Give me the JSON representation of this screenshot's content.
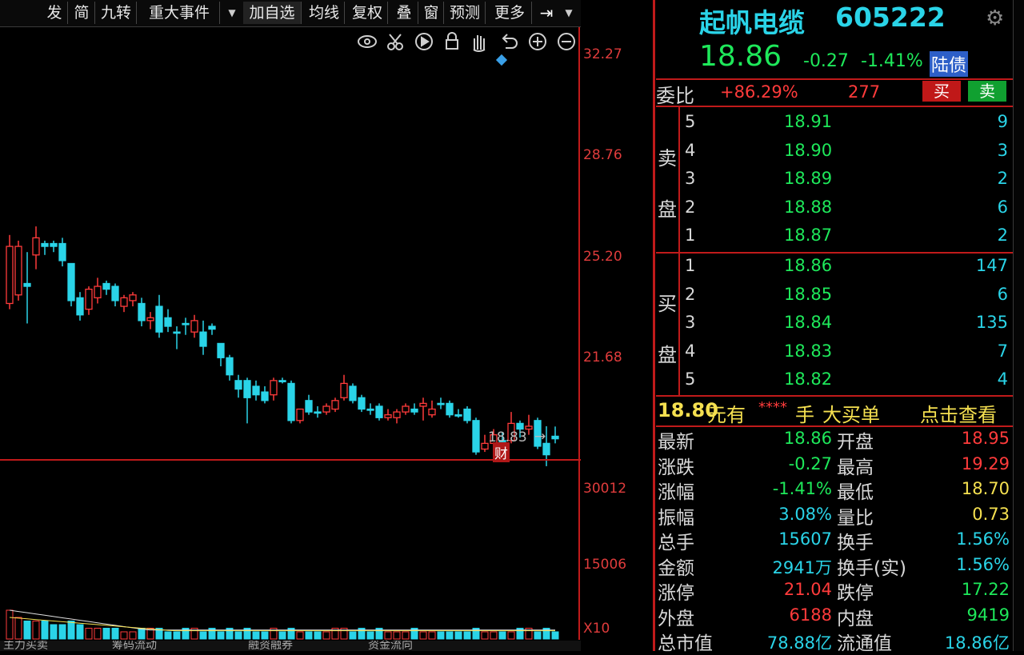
{
  "toolbar": {
    "items": [
      "发",
      "简",
      "九转",
      "重大事件",
      "加自选",
      "均线",
      "复权",
      "叠",
      "窗",
      "预测",
      "更多"
    ],
    "tool_icons": [
      "eye-icon",
      "scissors-icon",
      "play-icon",
      "lock-icon",
      "hand-icon",
      "undo-icon",
      "zoom-in-icon",
      "zoom-out-icon"
    ]
  },
  "chart": {
    "price_axis": [
      "32.27",
      "28.76",
      "25.20",
      "21.68"
    ],
    "volume_axis": [
      "30012",
      "15006"
    ],
    "volume_unit": "X10",
    "last_price_marker": "18.83",
    "finance_marker": "财",
    "bottom_tabs": [
      "主力买卖",
      "",
      "筹码流动",
      "融资融券",
      "资金流向"
    ]
  },
  "stock": {
    "name": "起帆电缆",
    "code": "605222",
    "price": "18.86",
    "change": "-0.27",
    "change_pct": "-1.41%",
    "tag": "陆债"
  },
  "weibi": {
    "label": "委比",
    "ratio": "+86.29%",
    "diff": "277",
    "buy_btn": "买",
    "sell_btn": "卖"
  },
  "orderbook": {
    "sell_label_1": "卖",
    "sell_label_2": "盘",
    "buy_label_1": "买",
    "buy_label_2": "盘",
    "sell": [
      {
        "level": "5",
        "price": "18.91",
        "volume": "9"
      },
      {
        "level": "4",
        "price": "18.90",
        "volume": "3"
      },
      {
        "level": "3",
        "price": "18.89",
        "volume": "2"
      },
      {
        "level": "2",
        "price": "18.88",
        "volume": "6"
      },
      {
        "level": "1",
        "price": "18.87",
        "volume": "2"
      }
    ],
    "buy": [
      {
        "level": "1",
        "price": "18.86",
        "volume": "147"
      },
      {
        "level": "2",
        "price": "18.85",
        "volume": "6"
      },
      {
        "level": "3",
        "price": "18.84",
        "volume": "135"
      },
      {
        "level": "4",
        "price": "18.83",
        "volume": "7"
      },
      {
        "level": "5",
        "price": "18.82",
        "volume": "4"
      }
    ]
  },
  "big_order": {
    "price": "18.80",
    "yuan_you": "元有",
    "stars": "****",
    "shou": "手",
    "big_buy": "大买单",
    "view": "点击查看"
  },
  "quote": [
    {
      "l1": "最新",
      "v1": "18.86",
      "l2": "开盘",
      "v2": "18.95"
    },
    {
      "l1": "涨跌",
      "v1": "-0.27",
      "l2": "最高",
      "v2": "19.29"
    },
    {
      "l1": "涨幅",
      "v1": "-1.41%",
      "l2": "最低",
      "v2": "18.70"
    },
    {
      "l1": "振幅",
      "v1": "3.08%",
      "l2": "量比",
      "v2": "0.73"
    },
    {
      "l1": "总手",
      "v1": "15607",
      "l2": "换手",
      "v2": "1.56%"
    },
    {
      "l1": "金额",
      "v1": "2941万",
      "l2": "换手(实)",
      "v2": "1.56%"
    },
    {
      "l1": "涨停",
      "v1": "21.04",
      "l2": "跌停",
      "v2": "17.22"
    },
    {
      "l1": "外盘",
      "v1": "6188",
      "l2": "内盘",
      "v2": "9419"
    },
    {
      "l1": "总市值",
      "v1": "78.88亿",
      "l2": "流通值",
      "v2": "18.86亿"
    }
  ],
  "colors": {
    "up": "#ff3b3b",
    "down": "#2ad4e8",
    "grid": "#c01a1a",
    "flat": "#1ee85a"
  },
  "chart_data": {
    "type": "candlestick",
    "price_range": [
      17.9,
      33.2
    ],
    "candles": [
      {
        "o": 23.6,
        "c": 25.6,
        "h": 26.0,
        "l": 23.4
      },
      {
        "o": 23.9,
        "c": 25.6,
        "h": 25.8,
        "l": 23.7
      },
      {
        "o": 24.3,
        "c": 24.2,
        "h": 25.4,
        "l": 22.9
      },
      {
        "o": 25.3,
        "c": 25.9,
        "h": 26.3,
        "l": 24.8
      },
      {
        "o": 25.7,
        "c": 25.6,
        "h": 25.8,
        "l": 25.3
      },
      {
        "o": 25.7,
        "c": 25.6,
        "h": 25.8,
        "l": 25.4
      },
      {
        "o": 25.7,
        "c": 25.1,
        "h": 25.9,
        "l": 24.9
      },
      {
        "o": 25.0,
        "c": 23.7,
        "h": 25.0,
        "l": 23.5
      },
      {
        "o": 23.8,
        "c": 23.2,
        "h": 24.0,
        "l": 23.0
      },
      {
        "o": 23.4,
        "c": 24.1,
        "h": 24.2,
        "l": 23.2
      },
      {
        "o": 23.8,
        "c": 24.2,
        "h": 24.5,
        "l": 23.6
      },
      {
        "o": 24.3,
        "c": 24.1,
        "h": 24.4,
        "l": 23.9
      },
      {
        "o": 24.2,
        "c": 23.7,
        "h": 24.3,
        "l": 23.5
      },
      {
        "o": 23.5,
        "c": 23.8,
        "h": 23.9,
        "l": 23.3
      },
      {
        "o": 23.7,
        "c": 23.9,
        "h": 24.0,
        "l": 23.5
      },
      {
        "o": 23.6,
        "c": 23.0,
        "h": 23.8,
        "l": 22.8
      },
      {
        "o": 23.0,
        "c": 23.1,
        "h": 23.3,
        "l": 22.7
      },
      {
        "o": 23.5,
        "c": 22.6,
        "h": 23.9,
        "l": 22.4
      },
      {
        "o": 23.1,
        "c": 22.8,
        "h": 23.4,
        "l": 22.6
      },
      {
        "o": 22.6,
        "c": 22.6,
        "h": 22.8,
        "l": 22.0
      },
      {
        "o": 22.9,
        "c": 22.9,
        "h": 23.1,
        "l": 22.5
      },
      {
        "o": 22.6,
        "c": 23.0,
        "h": 23.2,
        "l": 22.4
      },
      {
        "o": 22.6,
        "c": 22.1,
        "h": 23.0,
        "l": 21.8
      },
      {
        "o": 22.8,
        "c": 22.7,
        "h": 22.9,
        "l": 22.5
      },
      {
        "o": 22.2,
        "c": 21.7,
        "h": 22.2,
        "l": 21.4
      },
      {
        "o": 21.7,
        "c": 21.1,
        "h": 21.8,
        "l": 20.9
      },
      {
        "o": 20.9,
        "c": 20.6,
        "h": 21.1,
        "l": 20.3
      },
      {
        "o": 20.9,
        "c": 20.3,
        "h": 21.0,
        "l": 19.4
      },
      {
        "o": 20.7,
        "c": 20.4,
        "h": 20.9,
        "l": 20.2
      },
      {
        "o": 20.5,
        "c": 20.2,
        "h": 20.7,
        "l": 20.1
      },
      {
        "o": 20.4,
        "c": 20.9,
        "h": 21.0,
        "l": 20.2
      },
      {
        "o": 20.9,
        "c": 20.9,
        "h": 21.0,
        "l": 20.8
      },
      {
        "o": 20.8,
        "c": 19.5,
        "h": 20.9,
        "l": 19.4
      },
      {
        "o": 19.5,
        "c": 19.9,
        "h": 19.9,
        "l": 19.4
      },
      {
        "o": 20.2,
        "c": 19.8,
        "h": 20.4,
        "l": 19.7
      },
      {
        "o": 19.8,
        "c": 19.8,
        "h": 20.0,
        "l": 19.6
      },
      {
        "o": 19.8,
        "c": 20.0,
        "h": 20.1,
        "l": 19.7
      },
      {
        "o": 19.9,
        "c": 20.2,
        "h": 20.3,
        "l": 19.8
      },
      {
        "o": 20.3,
        "c": 20.8,
        "h": 21.1,
        "l": 20.2
      },
      {
        "o": 20.7,
        "c": 20.2,
        "h": 20.8,
        "l": 20.1
      },
      {
        "o": 20.3,
        "c": 19.9,
        "h": 20.4,
        "l": 19.8
      },
      {
        "o": 19.9,
        "c": 19.9,
        "h": 20.1,
        "l": 19.7
      },
      {
        "o": 20.0,
        "c": 19.6,
        "h": 20.1,
        "l": 19.5
      },
      {
        "o": 19.6,
        "c": 19.7,
        "h": 19.9,
        "l": 19.5
      },
      {
        "o": 19.6,
        "c": 19.8,
        "h": 19.9,
        "l": 19.4
      },
      {
        "o": 19.8,
        "c": 20.0,
        "h": 20.1,
        "l": 19.7
      },
      {
        "o": 19.9,
        "c": 19.8,
        "h": 20.1,
        "l": 19.7
      },
      {
        "o": 20.0,
        "c": 20.1,
        "h": 20.3,
        "l": 19.5
      },
      {
        "o": 19.7,
        "c": 19.9,
        "h": 20.2,
        "l": 19.6
      },
      {
        "o": 20.1,
        "c": 20.1,
        "h": 20.3,
        "l": 19.9
      },
      {
        "o": 20.1,
        "c": 19.7,
        "h": 20.2,
        "l": 19.6
      },
      {
        "o": 19.7,
        "c": 19.7,
        "h": 19.9,
        "l": 19.6
      },
      {
        "o": 19.9,
        "c": 19.5,
        "h": 20.0,
        "l": 19.4
      },
      {
        "o": 19.5,
        "c": 18.4,
        "h": 19.6,
        "l": 18.3
      },
      {
        "o": 18.5,
        "c": 18.7,
        "h": 19.0,
        "l": 18.4
      },
      {
        "o": 18.7,
        "c": 19.0,
        "h": 19.2,
        "l": 18.6
      },
      {
        "o": 18.8,
        "c": 18.8,
        "h": 19.1,
        "l": 18.6
      },
      {
        "o": 18.8,
        "c": 19.4,
        "h": 19.8,
        "l": 18.7
      },
      {
        "o": 19.4,
        "c": 19.2,
        "h": 19.5,
        "l": 18.9
      },
      {
        "o": 19.2,
        "c": 19.3,
        "h": 19.7,
        "l": 19.0
      },
      {
        "o": 19.5,
        "c": 18.6,
        "h": 19.6,
        "l": 18.5
      },
      {
        "o": 18.7,
        "c": 18.3,
        "h": 19.3,
        "l": 17.9
      },
      {
        "o": 18.95,
        "c": 18.86,
        "h": 19.29,
        "l": 18.7
      }
    ],
    "volumes": [
      8,
      6,
      5,
      5,
      5,
      4,
      4,
      5,
      4,
      3,
      3,
      3,
      3,
      2,
      2,
      3,
      3,
      3,
      2,
      2,
      3,
      3,
      2,
      3,
      2,
      3,
      2,
      3,
      2,
      2,
      3,
      2,
      3,
      2,
      2,
      2,
      2,
      3,
      3,
      2,
      3,
      2,
      3,
      2,
      2,
      2,
      3,
      2,
      2,
      2,
      2,
      2,
      2,
      3,
      2,
      2,
      2,
      2,
      3,
      3,
      2,
      3,
      2
    ]
  }
}
